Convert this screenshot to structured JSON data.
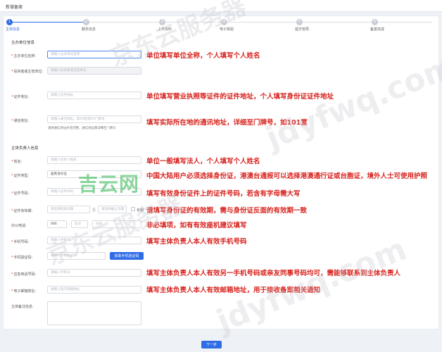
{
  "window": {
    "title": "新增备案"
  },
  "steps": [
    {
      "num": "1",
      "label": "主体信息",
      "active": true
    },
    {
      "num": "2",
      "label": "服务信息",
      "active": false
    },
    {
      "num": "3",
      "label": "上传资料",
      "active": false
    },
    {
      "num": "4",
      "label": "电子核验",
      "active": false
    },
    {
      "num": "5",
      "label": "提交管局",
      "active": false
    },
    {
      "num": "6",
      "label": "备案完成",
      "active": false
    }
  ],
  "unit_section": {
    "title": "主办单位信息",
    "name_label": "主办单位名称:",
    "name_placeholder": "请输入主办单位名称",
    "investor_label": "投资者或主管单位:",
    "investor_placeholder": "请输入投资者或主管单位",
    "id_addr_label": "证件地址:",
    "id_addr_placeholder": "请输入证件地址",
    "mail_addr_label": "通信地址:",
    "mail_addr_placeholder": "请输入通信地址，如XX街道XX门牌号",
    "mail_addr_hint": "请将通信地址补充完整，通信地址需详细至门牌号"
  },
  "person_section": {
    "title": "主体负责人信息",
    "name_label": "姓名:",
    "name_placeholder": "请输入负责人姓名",
    "id_type_label": "证件类型:",
    "id_type_value": "居民身份证",
    "id_no_label": "证件号码:",
    "id_no_placeholder": "请输入证件号码",
    "validity_label": "证件有效期:",
    "validity_start": "请选择起始日期",
    "validity_sep": "至",
    "validity_end": "请选择截止日期",
    "long_term": "长期",
    "office_phone_label": "办公电话:",
    "office_phone_area": "086",
    "office_phone_zone": "区号",
    "office_phone_num": "号码",
    "mobile_label": "手机号码:",
    "mobile_placeholder": "请输入手机号",
    "code_label": "手机验证码:",
    "code_placeholder": "请输入手机验证码",
    "code_button": "获取手机验证码",
    "emergency_label": "应急电话号码:",
    "emergency_placeholder": "请输入手机号",
    "email_label": "电子邮箱地址:",
    "email_placeholder": "请输入电子邮箱地址",
    "remark_label": "主体备注信息:"
  },
  "annotations": {
    "unit_name": "单位填写单位全称，个人填写个人姓名",
    "id_addr": "单位填写营业执照等证件的证件地址，个人填写身份证证件地址",
    "mail_addr": "填写实际所在地的通讯地址，详细至门牌号，如101室",
    "person_name": "单位一般填写法人，个人填写个人姓名",
    "id_type": "中国大陆用户必须选择身份证，港澳台通报可以选择港澳通行证或台胞证，境外人士可使用护照",
    "id_no": "填写有效身份证件上的证件号码，若含有字母需大写",
    "validity": "请填写身份证的有效期，需与身份证反面的有效期一致",
    "office_phone": "非必填项，如有有效座机建议填写",
    "mobile": "填写主体负责人本人有效手机号码",
    "emergency": "填写主体负责人本人有效另一手机号码或亲友同事号码均可，需能够联系到主体负责人",
    "email": "填写主体负责人本人有效邮箱地址，用于接收备案相关通知"
  },
  "footer": {
    "next_button": "下一步"
  },
  "watermarks": {
    "brand_cn": "京东云服务器",
    "brand_url": "jdyfwq.com",
    "center_logo": "吉云网"
  },
  "colors": {
    "accent": "#2f6ce5",
    "annotation": "#d8231e",
    "required": "#e33"
  }
}
